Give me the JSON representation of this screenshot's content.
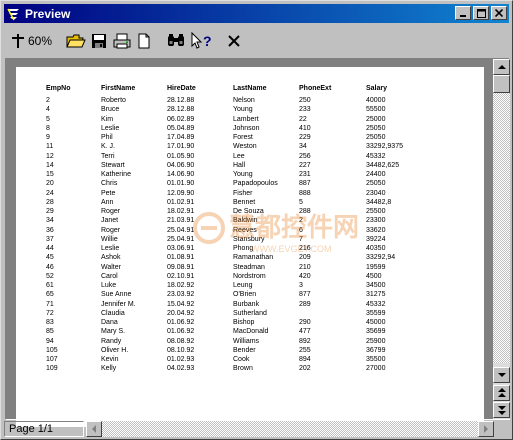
{
  "window": {
    "title": "Preview",
    "controls": [
      "minimize",
      "maximize",
      "close"
    ]
  },
  "toolbar": {
    "zoom_label": "60%",
    "tools": [
      "zoom-icon",
      "open-folder-icon",
      "save-icon",
      "print-icon",
      "new-page-icon",
      "find-icon",
      "help-pointer-icon",
      "close-icon"
    ]
  },
  "report": {
    "columns": [
      "EmpNo",
      "FirstName",
      "HireDate",
      "LastName",
      "PhoneExt",
      "Salary"
    ],
    "rows": [
      [
        "2",
        "Roberto",
        "28.12.88",
        "Nelson",
        "250",
        "40000"
      ],
      [
        "4",
        "Bruce",
        "28.12.88",
        "Young",
        "233",
        "55500"
      ],
      [
        "5",
        "Kim",
        "06.02.89",
        "Lambert",
        "22",
        "25000"
      ],
      [
        "8",
        "Leslie",
        "05.04.89",
        "Johnson",
        "410",
        "25050"
      ],
      [
        "9",
        "Phil",
        "17.04.89",
        "Forest",
        "229",
        "25050"
      ],
      [
        "11",
        "K. J.",
        "17.01.90",
        "Weston",
        "34",
        "33292,9375"
      ],
      [
        "12",
        "Terri",
        "01.05.90",
        "Lee",
        "256",
        "45332"
      ],
      [
        "14",
        "Stewart",
        "04.06.90",
        "Hall",
        "227",
        "34482,625"
      ],
      [
        "15",
        "Katherine",
        "14.06.90",
        "Young",
        "231",
        "24400"
      ],
      [
        "20",
        "Chris",
        "01.01.90",
        "Papadopoulos",
        "887",
        "25050"
      ],
      [
        "24",
        "Pete",
        "12.09.90",
        "Fisher",
        "888",
        "23040"
      ],
      [
        "28",
        "Ann",
        "01.02.91",
        "Bennet",
        "5",
        "34482,8"
      ],
      [
        "29",
        "Roger",
        "18.02.91",
        "De Souza",
        "288",
        "25500"
      ],
      [
        "34",
        "Janet",
        "21.03.91",
        "Baldwin",
        "2",
        "23300"
      ],
      [
        "36",
        "Roger",
        "25.04.91",
        "Reeves",
        "6",
        "33620"
      ],
      [
        "37",
        "Willie",
        "25.04.91",
        "Stansbury",
        "7",
        "39224"
      ],
      [
        "44",
        "Leslie",
        "03.06.91",
        "Phong",
        "216",
        "40350"
      ],
      [
        "45",
        "Ashok",
        "01.08.91",
        "Ramanathan",
        "209",
        "33292,94"
      ],
      [
        "46",
        "Walter",
        "09.08.91",
        "Steadman",
        "210",
        "19599"
      ],
      [
        "52",
        "Carol",
        "02.10.91",
        "Nordstrom",
        "420",
        "4500"
      ],
      [
        "61",
        "Luke",
        "18.02.92",
        "Leung",
        "3",
        "34500"
      ],
      [
        "65",
        "Sue Anne",
        "23.03.92",
        "O'Brien",
        "877",
        "31275"
      ],
      [
        "71",
        "Jennifer M.",
        "15.04.92",
        "Burbank",
        "289",
        "45332"
      ],
      [
        "72",
        "Claudia",
        "20.04.92",
        "Sutherland",
        "",
        "35599"
      ],
      [
        "83",
        "Dana",
        "01.06.92",
        "Bishop",
        "290",
        "45000"
      ],
      [
        "85",
        "Mary S.",
        "01.06.92",
        "MacDonald",
        "477",
        "35699"
      ],
      [
        "94",
        "Randy",
        "08.08.92",
        "Williams",
        "892",
        "25900"
      ],
      [
        "105",
        "Oliver H.",
        "08.10.92",
        "Bender",
        "255",
        "36799"
      ],
      [
        "107",
        "Kevin",
        "01.02.93",
        "Cook",
        "894",
        "35500"
      ],
      [
        "109",
        "Kelly",
        "04.02.93",
        "Brown",
        "202",
        "27000"
      ]
    ]
  },
  "status": {
    "page_label": "Page 1/1"
  },
  "watermark": {
    "text_top": "慧都控件网",
    "text_bottom": "WWW.EVGET.COM"
  },
  "colors": {
    "titlebar_start": "#000080",
    "titlebar_end": "#1084d0",
    "window_face": "#c0c0c0",
    "workspace": "#808080",
    "watermark": "#e8842a"
  }
}
